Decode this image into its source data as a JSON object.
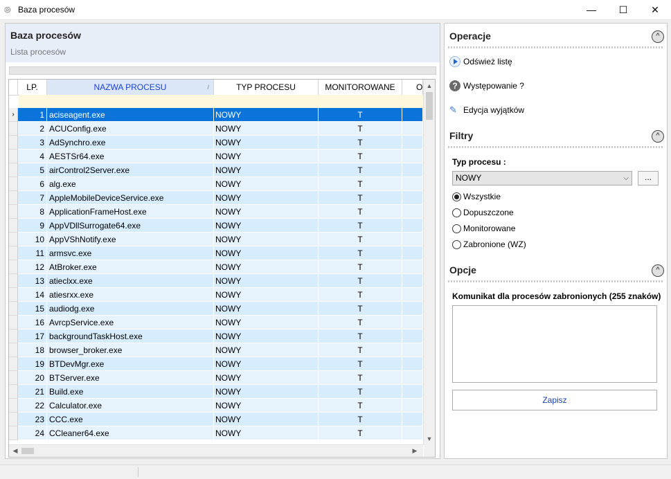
{
  "window": {
    "title": "Baza procesów",
    "minimize": "—",
    "maximize": "☐",
    "close": "✕"
  },
  "left_panel": {
    "title": "Baza procesów",
    "subtitle": "Lista procesów"
  },
  "grid": {
    "columns": [
      "LP.",
      "NAZWA PROCESU",
      "TYP PROCESU",
      "MONITOROWANE",
      "O"
    ],
    "sorted_column": "NAZWA PROCESU",
    "selected_row": 1,
    "rows": [
      {
        "lp": "1",
        "name": "aciseagent.exe",
        "type": "NOWY",
        "mon": "T"
      },
      {
        "lp": "2",
        "name": "ACUConfig.exe",
        "type": "NOWY",
        "mon": "T"
      },
      {
        "lp": "3",
        "name": "AdSynchro.exe",
        "type": "NOWY",
        "mon": "T"
      },
      {
        "lp": "4",
        "name": "AESTSr64.exe",
        "type": "NOWY",
        "mon": "T"
      },
      {
        "lp": "5",
        "name": "airControl2Server.exe",
        "type": "NOWY",
        "mon": "T"
      },
      {
        "lp": "6",
        "name": "alg.exe",
        "type": "NOWY",
        "mon": "T"
      },
      {
        "lp": "7",
        "name": "AppleMobileDeviceService.exe",
        "type": "NOWY",
        "mon": "T"
      },
      {
        "lp": "8",
        "name": "ApplicationFrameHost.exe",
        "type": "NOWY",
        "mon": "T"
      },
      {
        "lp": "9",
        "name": "AppVDllSurrogate64.exe",
        "type": "NOWY",
        "mon": "T"
      },
      {
        "lp": "10",
        "name": "AppVShNotify.exe",
        "type": "NOWY",
        "mon": "T"
      },
      {
        "lp": "11",
        "name": "armsvc.exe",
        "type": "NOWY",
        "mon": "T"
      },
      {
        "lp": "12",
        "name": "AtBroker.exe",
        "type": "NOWY",
        "mon": "T"
      },
      {
        "lp": "13",
        "name": "atieclxx.exe",
        "type": "NOWY",
        "mon": "T"
      },
      {
        "lp": "14",
        "name": "atiesrxx.exe",
        "type": "NOWY",
        "mon": "T"
      },
      {
        "lp": "15",
        "name": "audiodg.exe",
        "type": "NOWY",
        "mon": "T"
      },
      {
        "lp": "16",
        "name": "AvrcpService.exe",
        "type": "NOWY",
        "mon": "T"
      },
      {
        "lp": "17",
        "name": "backgroundTaskHost.exe",
        "type": "NOWY",
        "mon": "T"
      },
      {
        "lp": "18",
        "name": "browser_broker.exe",
        "type": "NOWY",
        "mon": "T"
      },
      {
        "lp": "19",
        "name": "BTDevMgr.exe",
        "type": "NOWY",
        "mon": "T"
      },
      {
        "lp": "20",
        "name": "BTServer.exe",
        "type": "NOWY",
        "mon": "T"
      },
      {
        "lp": "21",
        "name": "Build.exe",
        "type": "NOWY",
        "mon": "T"
      },
      {
        "lp": "22",
        "name": "Calculator.exe",
        "type": "NOWY",
        "mon": "T"
      },
      {
        "lp": "23",
        "name": "CCC.exe",
        "type": "NOWY",
        "mon": "T"
      },
      {
        "lp": "24",
        "name": "CCleaner64.exe",
        "type": "NOWY",
        "mon": "T"
      }
    ]
  },
  "operations": {
    "title": "Operacje",
    "refresh": "Odśwież listę",
    "occurrence": "Występowanie ?",
    "edit_exceptions": "Edycja wyjątków"
  },
  "filters": {
    "title": "Filtry",
    "type_label": "Typ procesu :",
    "type_value": "NOWY",
    "ellipsis": "...",
    "options": [
      "Wszystkie",
      "Dopuszczone",
      "Monitorowane",
      "Zabronione (WZ)"
    ],
    "selected": 0
  },
  "options": {
    "title": "Opcje",
    "message_label": "Komunikat dla procesów zabronionych (255 znaków)",
    "message_value": "",
    "save": "Zapisz"
  },
  "icons": {
    "collapse": "^",
    "row_pointer": "›",
    "scroll_up": "▲",
    "scroll_down": "▼",
    "scroll_left": "◀",
    "scroll_right": "▶",
    "sort": "/",
    "combo_arrow": "⌵"
  }
}
